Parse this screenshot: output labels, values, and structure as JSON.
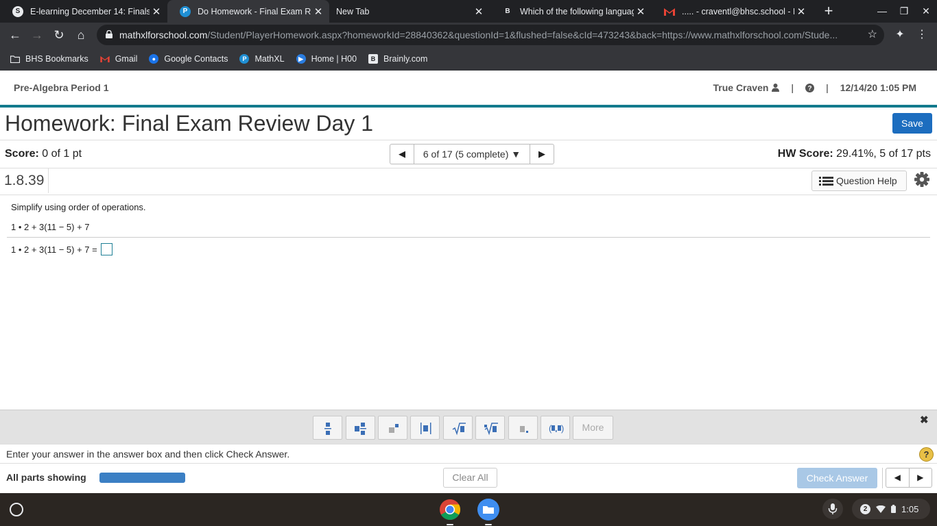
{
  "browser": {
    "tabs": [
      {
        "title": "E-learning December 14: Finals",
        "icon": "schoology-icon",
        "active": false
      },
      {
        "title": "Do Homework - Final Exam Rev",
        "icon": "pearson-icon",
        "active": true
      },
      {
        "title": "New Tab",
        "icon": "",
        "active": false
      },
      {
        "title": "Which of the following languag",
        "icon": "brainly-icon",
        "active": false
      },
      {
        "title": "..... - craventl@bhsc.school - Bo",
        "icon": "gmail-icon",
        "active": false
      }
    ],
    "url_host": "mathxlforschool.com",
    "url_path": "/Student/PlayerHomework.aspx?homeworkId=28840362&questionId=1&flushed=false&cId=473243&back=https://www.mathxlforschool.com/Stude...",
    "bookmarks": [
      {
        "label": "BHS Bookmarks",
        "icon": "folder-icon"
      },
      {
        "label": "Gmail",
        "icon": "gmail-icon"
      },
      {
        "label": "Google Contacts",
        "icon": "contacts-icon"
      },
      {
        "label": "MathXL",
        "icon": "pearson-icon"
      },
      {
        "label": "Home | H00",
        "icon": "play-icon"
      },
      {
        "label": "Brainly.com",
        "icon": "brainly-icon"
      }
    ]
  },
  "site": {
    "course": "Pre-Algebra Period 1",
    "user": "True Craven",
    "datetime": "12/14/20 1:05 PM"
  },
  "homework": {
    "title": "Homework: Final Exam Review Day 1",
    "save_label": "Save",
    "score_label": "Score:",
    "score_value": "0 of 1 pt",
    "nav_text": "6 of 17 (5 complete)",
    "hw_score_label": "HW Score:",
    "hw_score_value": "29.41%, 5 of 17 pts",
    "question_id": "1.8.39",
    "question_help": "Question Help"
  },
  "question": {
    "instruction": "Simplify using order of operations.",
    "expression": "1 • 2 + 3(11 − 5) + 7",
    "answer_prompt": "1 • 2 + 3(11 − 5) + 7 =",
    "answer_value": ""
  },
  "palette": {
    "buttons": [
      "fraction-icon",
      "mixed-number-icon",
      "exponent-icon",
      "absolute-value-icon",
      "square-root-icon",
      "nth-root-icon",
      "decimal-icon",
      "ordered-pair-icon"
    ],
    "more_label": "More"
  },
  "footer": {
    "hint": "Enter your answer in the answer box and then click Check Answer.",
    "parts_label": "All parts showing",
    "parts_progress": 1.0,
    "clear_all": "Clear All",
    "check_answer": "Check Answer"
  },
  "shelf": {
    "notification_count": "2",
    "time": "1:05"
  }
}
